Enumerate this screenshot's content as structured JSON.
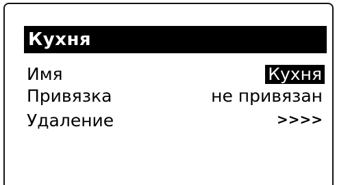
{
  "screen": {
    "title": "Кухня",
    "items": [
      {
        "label": "Имя",
        "value": "Кухня",
        "selected": true
      },
      {
        "label": "Привязка",
        "value": "не привязан",
        "selected": false
      },
      {
        "label": "Удаление",
        "value": ">>>>",
        "selected": false
      }
    ]
  },
  "colors": {
    "background": "#ffffff",
    "foreground": "#000000",
    "highlight": "#000000"
  }
}
